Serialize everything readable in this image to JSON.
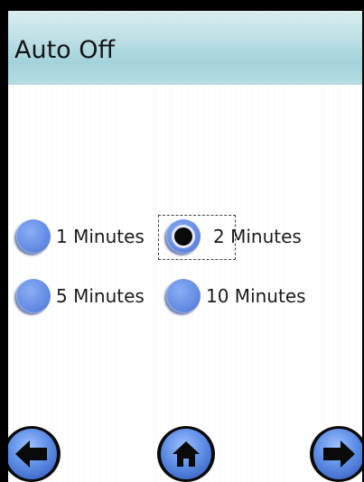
{
  "header": {
    "title": "Auto Off"
  },
  "options": [
    {
      "label": "1 Minutes",
      "selected": false
    },
    {
      "label": "2 Minutes",
      "selected": true
    },
    {
      "label": "5 Minutes",
      "selected": false
    },
    {
      "label": "10 Minutes",
      "selected": false
    }
  ],
  "nav": {
    "back_icon": "arrow-left-icon",
    "home_icon": "home-icon",
    "forward_icon": "arrow-right-icon"
  },
  "colors": {
    "title_bar": "#a3d3da",
    "radio": "#6c94e8",
    "radio_dot": "#0a0a0a"
  }
}
